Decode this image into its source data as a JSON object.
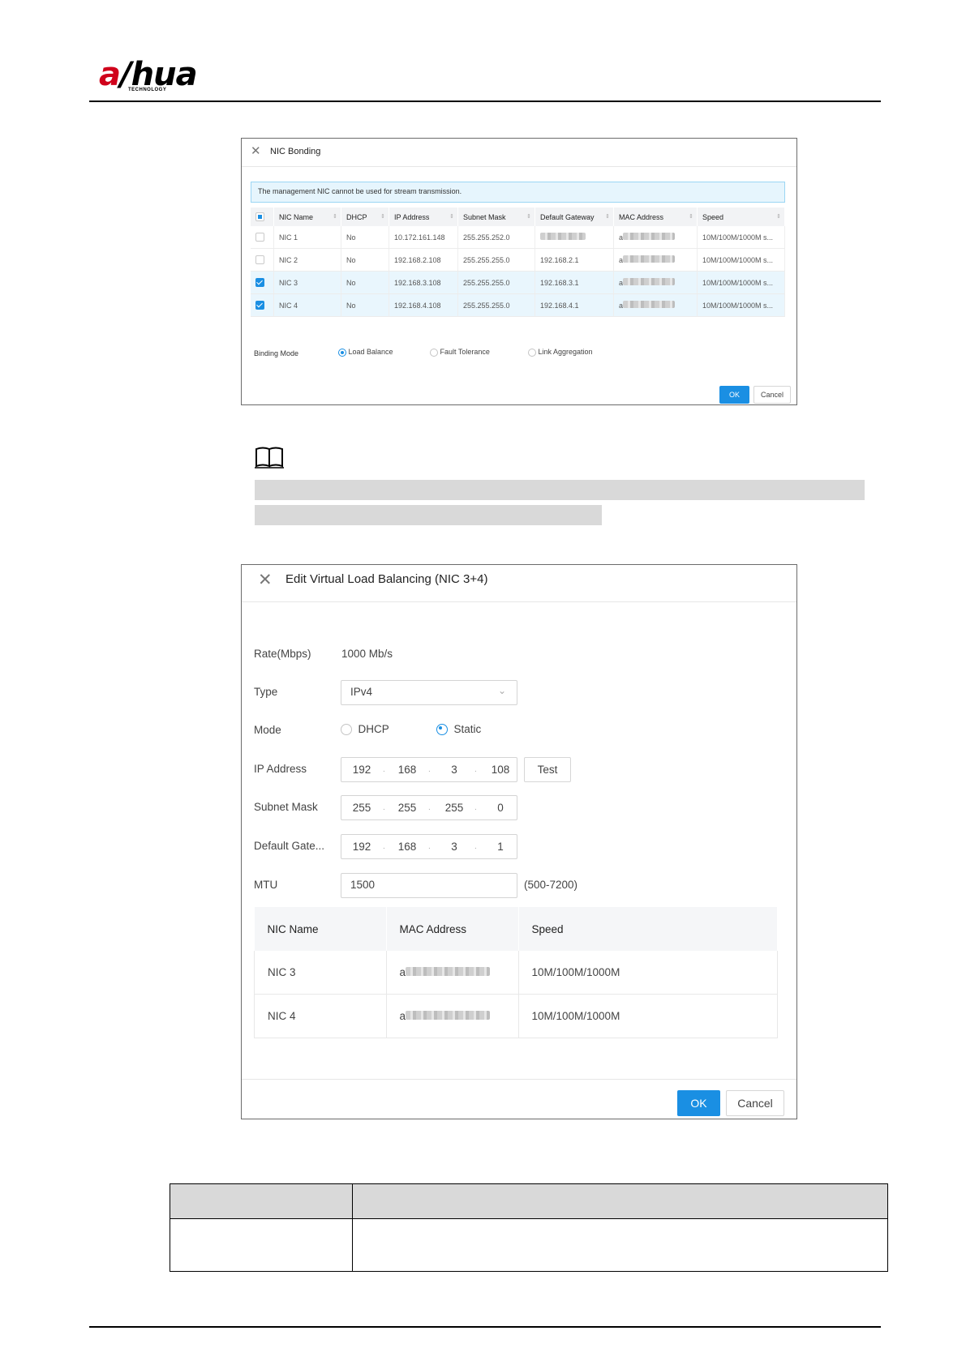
{
  "header": {
    "logo_text": "alhua",
    "logo_sub": "TECHNOLOGY"
  },
  "nic_bonding": {
    "title": "NIC Bonding",
    "info": "The management NIC cannot be used for stream transmission.",
    "columns": [
      "NIC Name",
      "DHCP",
      "IP Address",
      "Subnet Mask",
      "Default Gateway",
      "MAC Address",
      "Speed"
    ],
    "rows": [
      {
        "checked": false,
        "name": "NIC 1",
        "dhcp": "No",
        "ip": "10.172.161.148",
        "mask": "255.255.252.0",
        "gateway": "",
        "mac_prefix": "a",
        "speed": "10M/100M/1000M s..."
      },
      {
        "checked": false,
        "name": "NIC 2",
        "dhcp": "No",
        "ip": "192.168.2.108",
        "mask": "255.255.255.0",
        "gateway": "192.168.2.1",
        "mac_prefix": "a",
        "speed": "10M/100M/1000M s..."
      },
      {
        "checked": true,
        "name": "NIC 3",
        "dhcp": "No",
        "ip": "192.168.3.108",
        "mask": "255.255.255.0",
        "gateway": "192.168.3.1",
        "mac_prefix": "a",
        "speed": "10M/100M/1000M s..."
      },
      {
        "checked": true,
        "name": "NIC 4",
        "dhcp": "No",
        "ip": "192.168.4.108",
        "mask": "255.255.255.0",
        "gateway": "192.168.4.1",
        "mac_prefix": "a",
        "speed": "10M/100M/1000M s..."
      }
    ],
    "binding_mode_label": "Binding Mode",
    "modes": [
      "Load Balance",
      "Fault Tolerance",
      "Link Aggregation"
    ],
    "selected_mode": "Load Balance",
    "ok": "OK",
    "cancel": "Cancel"
  },
  "edit_dialog": {
    "title": "Edit Virtual Load Balancing (NIC 3+4)",
    "rate_label": "Rate(Mbps)",
    "rate_value": "1000 Mb/s",
    "type_label": "Type",
    "type_value": "IPv4",
    "mode_label": "Mode",
    "mode_options": [
      "DHCP",
      "Static"
    ],
    "mode_selected": "Static",
    "ip_label": "IP Address",
    "ip": [
      "192",
      "168",
      "3",
      "108"
    ],
    "test_label": "Test",
    "mask_label": "Subnet Mask",
    "mask": [
      "255",
      "255",
      "255",
      "0"
    ],
    "gateway_label": "Default Gate...",
    "gateway": [
      "192",
      "168",
      "3",
      "1"
    ],
    "mtu_label": "MTU",
    "mtu_value": "1500",
    "mtu_range": "(500-7200)",
    "table_columns": [
      "NIC Name",
      "MAC Address",
      "Speed"
    ],
    "table_rows": [
      {
        "name": "NIC 3",
        "mac_prefix": "a",
        "speed": "10M/100M/1000M"
      },
      {
        "name": "NIC 4",
        "mac_prefix": "a",
        "speed": "10M/100M/1000M"
      }
    ],
    "ok": "OK",
    "cancel": "Cancel"
  },
  "colors": {
    "accent": "#1a8fe3",
    "logo_red": "#d0021b"
  }
}
